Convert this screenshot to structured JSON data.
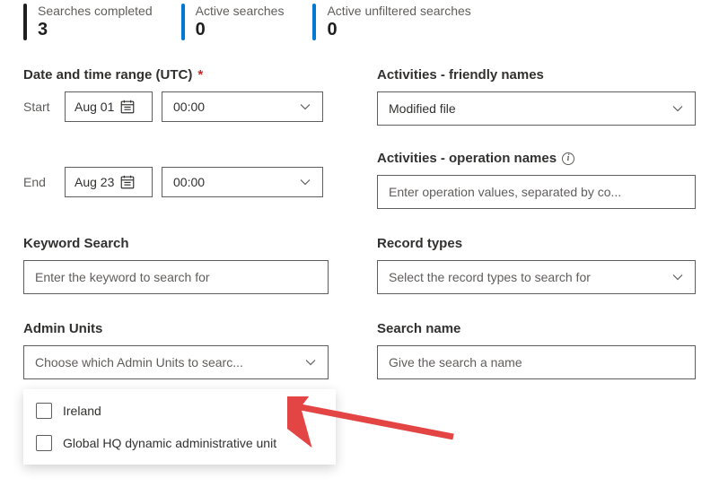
{
  "stats": {
    "completed": {
      "label": "Searches completed",
      "value": "3"
    },
    "active": {
      "label": "Active searches",
      "value": "0"
    },
    "unfiltered": {
      "label": "Active unfiltered searches",
      "value": "0"
    }
  },
  "dateRange": {
    "heading": "Date and time range (UTC)",
    "required": "*",
    "startLabel": "Start",
    "startDate": "Aug 01",
    "startTime": "00:00",
    "endLabel": "End",
    "endDate": "Aug 23",
    "endTime": "00:00"
  },
  "activitiesFriendly": {
    "heading": "Activities - friendly names",
    "value": "Modified file"
  },
  "activitiesOperation": {
    "heading": "Activities - operation names",
    "placeholder": "Enter operation values, separated by co..."
  },
  "keywordSearch": {
    "heading": "Keyword Search",
    "placeholder": "Enter the keyword to search for"
  },
  "recordTypes": {
    "heading": "Record types",
    "placeholder": "Select the record types to search for"
  },
  "adminUnits": {
    "heading": "Admin Units",
    "placeholder": "Choose which Admin Units to searc...",
    "options": [
      "Ireland",
      "Global HQ dynamic administrative unit"
    ]
  },
  "searchName": {
    "heading": "Search name",
    "placeholder": "Give the search a name"
  }
}
